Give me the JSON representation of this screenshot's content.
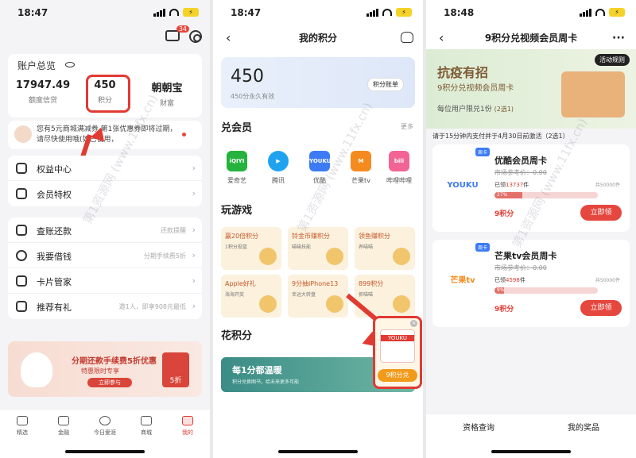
{
  "status": {
    "time1": "18:47",
    "time2": "18:47",
    "time3": "18:48",
    "battery": "⚡"
  },
  "p1": {
    "msg_badge": "34",
    "account_title": "账户总览",
    "stats": [
      {
        "value": "17947.49",
        "label": "额度信贷"
      },
      {
        "value": "450",
        "label": "积分"
      },
      {
        "value": "朝朝宝",
        "label": "财富"
      }
    ],
    "notice": "您有5元商城满减券 第1张优惠券即将过期，请尽快使用哦(如已使用，",
    "menu1": [
      {
        "label": "权益中心"
      },
      {
        "label": "会员特权"
      }
    ],
    "menu2": [
      {
        "label": "查账还款",
        "hint": "还款提醒"
      },
      {
        "label": "我要借钱",
        "hint": "分期手续费5折"
      },
      {
        "label": "卡片管家",
        "hint": ""
      },
      {
        "label": "推荐有礼",
        "hint": "邀1人，即享908元最低"
      }
    ],
    "promo": {
      "title": "分期还款手续费5折优惠",
      "sub": "特惠限时专享",
      "btn": "立即参与",
      "gift": "5折"
    },
    "tabs": [
      "精选",
      "金融",
      "今日爱涯",
      "商城",
      "我的"
    ]
  },
  "p2": {
    "title": "我的积分",
    "points": "450",
    "points_sub": "450分永久有效",
    "ledger": "积分账单",
    "sec_member": "兑会员",
    "more": "更多",
    "brands": [
      {
        "name": "爱奇艺",
        "logo": "iQIYI",
        "color": "#25b33d"
      },
      {
        "name": "腾讯",
        "logo": "▶",
        "color": "#1fa3ef"
      },
      {
        "name": "优酷",
        "logo": "YOUKU",
        "color": "#3d7bf5"
      },
      {
        "name": "芒果tv",
        "logo": "M",
        "color": "#f58b1f"
      },
      {
        "name": "哔哩哔哩",
        "logo": "bili",
        "color": "#f26493"
      }
    ],
    "sec_game": "玩游戏",
    "games": [
      {
        "title": "赢20倍积分",
        "sub": "1积分投篮"
      },
      {
        "title": "铃金币赚积分",
        "sub": "喵喵技能"
      },
      {
        "title": "领鱼赚积分",
        "sub": "养喵喵"
      },
      {
        "title": "Apple好礼",
        "sub": "海海开奖"
      },
      {
        "title": "9分抽iPhone13",
        "sub": "幸运大转盘"
      },
      {
        "title": "899积分",
        "sub": "抓喵喵"
      }
    ],
    "sec_spend": "花积分",
    "spend_more": "更多",
    "banner_title": "每1分都温暖",
    "banner_sub": "积分兑换图书，给未来更多可能",
    "float_logo": "YOUKU",
    "float_btn": "9积分兑",
    "float_close": "×"
  },
  "p3": {
    "title": "9积分兑视频会员周卡",
    "more": "···",
    "hero_t1": "抗疫有招",
    "hero_t2": "9积分兑视频会员周卡",
    "hero_t3": "每位用户限兑1份",
    "hero_t3b": "(2选1)",
    "rules": "活动规则",
    "hint": "请于15分钟内支付并于4月30日前激活（2选1）",
    "offers": [
      {
        "tag": "周卡",
        "logo": "YOUKU",
        "logo_color": "#3d7bf5",
        "title": "优酷会员周卡",
        "orig": "市场参考价：0.00",
        "sold": "已领",
        "sold_num": "13737",
        "sold_unit": "件",
        "total": "共50000件",
        "pct": 27,
        "pct_text": "27%",
        "price": "9积分",
        "btn": "立即领"
      },
      {
        "tag": "周卡",
        "logo": "芒果tv",
        "logo_color": "#f58b1f",
        "title": "芒果tv会员周卡",
        "orig": "市场参考价：0.00",
        "sold": "已领",
        "sold_num": "4598",
        "sold_unit": "件",
        "total": "共50000件",
        "pct": 9,
        "pct_text": "9%",
        "price": "9积分",
        "btn": "立即领"
      }
    ],
    "foot": [
      "资格查询",
      "我的奖品"
    ]
  },
  "watermark": "第1资源网 (www.11fx.cn)"
}
